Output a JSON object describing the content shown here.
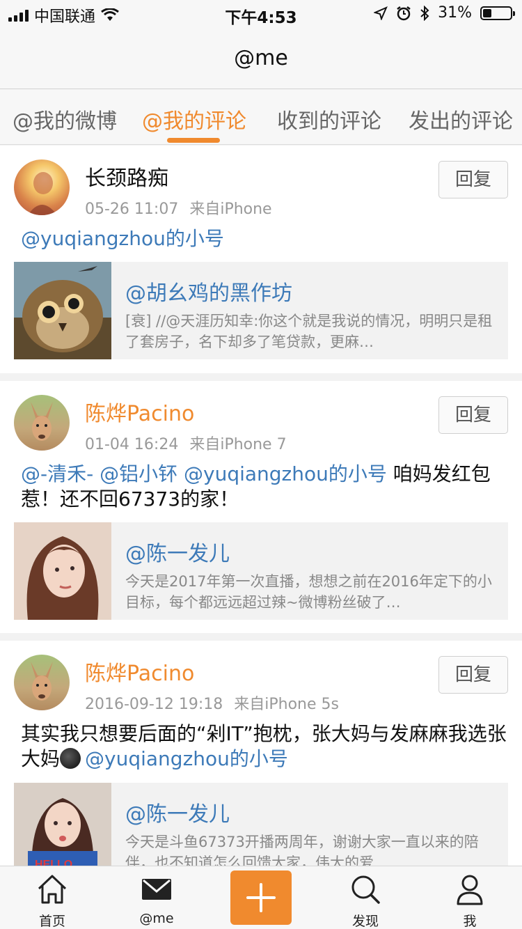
{
  "status_bar": {
    "carrier": "中国联通",
    "time": "下午4:53",
    "battery": "31%",
    "battery_level": 0.31
  },
  "nav": {
    "title": "@me"
  },
  "tabs": [
    {
      "label": "@我的微博",
      "active": false
    },
    {
      "label": "@我的评论",
      "active": true
    },
    {
      "label": "收到的评论",
      "active": false
    },
    {
      "label": "发出的评论",
      "active": false
    }
  ],
  "reply_label": "回复",
  "comments": [
    {
      "author": "长颈路痴",
      "date": "05-26 11:07",
      "source": "来自iPhone",
      "mentions": "@yuqiangzhou的小号",
      "text": "",
      "quote": {
        "title": "@胡幺鸡的黑作坊",
        "text": "[衰] //@天涯历知幸:你这个就是我说的情况，明明只是租了套房子，名下却多了笔贷款，更麻…"
      }
    },
    {
      "author": "陈烨Pacino",
      "date": "01-04 16:24",
      "source": "来自iPhone 7",
      "mentions": "@-清禾- @铝小钚 @yuqiangzhou的小号",
      "text": " 咱妈发红包惹！还不回67373的家！",
      "quote": {
        "title": "@陈一发儿",
        "text": "今天是2017年第一次直播，想想之前在2016年定下的小目标，每个都远远超过辣~微博粉丝破了…"
      }
    },
    {
      "author": "陈烨Pacino",
      "date": "2016-09-12 19:18",
      "source": "来自iPhone 5s",
      "text": "其实我只想要后面的“剁IT”抱枕，张大妈与发麻麻我选张大妈",
      "mentions": "@yuqiangzhou的小号",
      "quote": {
        "title": "@陈一发儿",
        "text": "今天是斗鱼67373开播两周年，谢谢大家一直以来的陪伴，也不知道怎么回馈大家，伟大的爱…"
      }
    }
  ],
  "tabbar": {
    "home": "首页",
    "me_msg": "@me",
    "discover": "发现",
    "profile": "我"
  },
  "colors": {
    "accent": "#f08a2e",
    "link": "#3d7ab8"
  },
  "icons": [
    "signal-icon",
    "wifi-icon",
    "location-icon",
    "alarm-icon",
    "bluetooth-icon",
    "battery-icon",
    "home-icon",
    "mail-icon",
    "plus-icon",
    "search-icon",
    "person-icon"
  ]
}
